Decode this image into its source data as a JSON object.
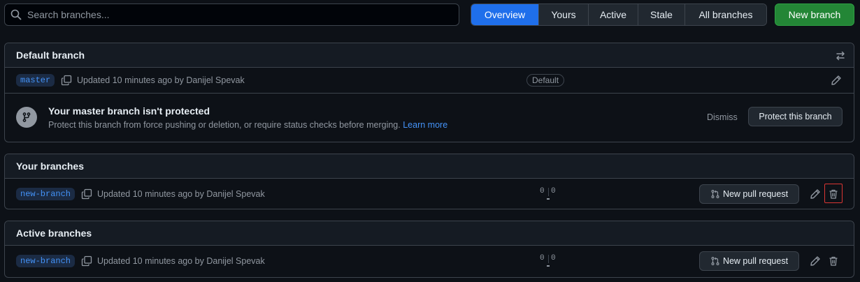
{
  "search": {
    "placeholder": "Search branches..."
  },
  "tabs": [
    {
      "label": "Overview",
      "selected": true
    },
    {
      "label": "Yours",
      "selected": false
    },
    {
      "label": "Active",
      "selected": false
    },
    {
      "label": "Stale",
      "selected": false
    },
    {
      "label": "All branches",
      "selected": false
    }
  ],
  "new_branch_label": "New branch",
  "default_section": {
    "title": "Default branch",
    "branch": {
      "name": "master",
      "updated": "Updated 10 minutes ago by Danijel Spevak",
      "badge": "Default"
    },
    "protection": {
      "title": "Your master branch isn't protected",
      "description": "Protect this branch from force pushing or deletion, or require status checks before merging.",
      "link": "Learn more",
      "dismiss": "Dismiss",
      "protect_button": "Protect this branch"
    }
  },
  "your_section": {
    "title": "Your branches",
    "branch": {
      "name": "new-branch",
      "updated": "Updated 10 minutes ago by Danijel Spevak",
      "behind": "0",
      "ahead": "0",
      "pr_button": "New pull request"
    }
  },
  "active_section": {
    "title": "Active branches",
    "branch": {
      "name": "new-branch",
      "updated": "Updated 10 minutes ago by Danijel Spevak",
      "behind": "0",
      "ahead": "0",
      "pr_button": "New pull request"
    }
  },
  "colors": {
    "accent": "#1f6feb",
    "primary_button": "#238636",
    "link": "#4493f8",
    "highlight": "#da3633"
  }
}
